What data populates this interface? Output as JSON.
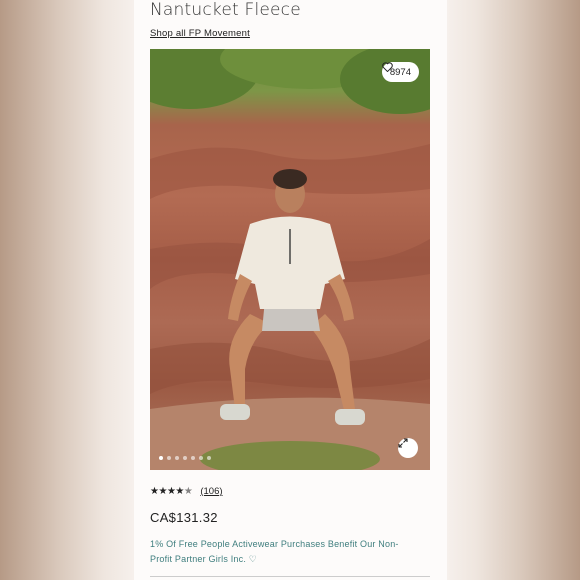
{
  "product": {
    "title": "Nantucket Fleece",
    "shop_link": "Shop all FP Movement",
    "like_count": "8974",
    "rating": 4.5,
    "rating_max": 5,
    "review_count": "(106)",
    "price": "CA$131.32",
    "charity_note": "1% Of Free People Activewear Purchases Benefit Our Non-Profit Partner Girls Inc. ♡"
  },
  "gallery": {
    "image_count": 7,
    "active_index": 0
  },
  "icons": {
    "like": "heart-icon",
    "expand": "expand-icon",
    "star": "star-icon"
  },
  "colors": {
    "accent_teal": "#3f7e7e",
    "text": "#222222"
  }
}
